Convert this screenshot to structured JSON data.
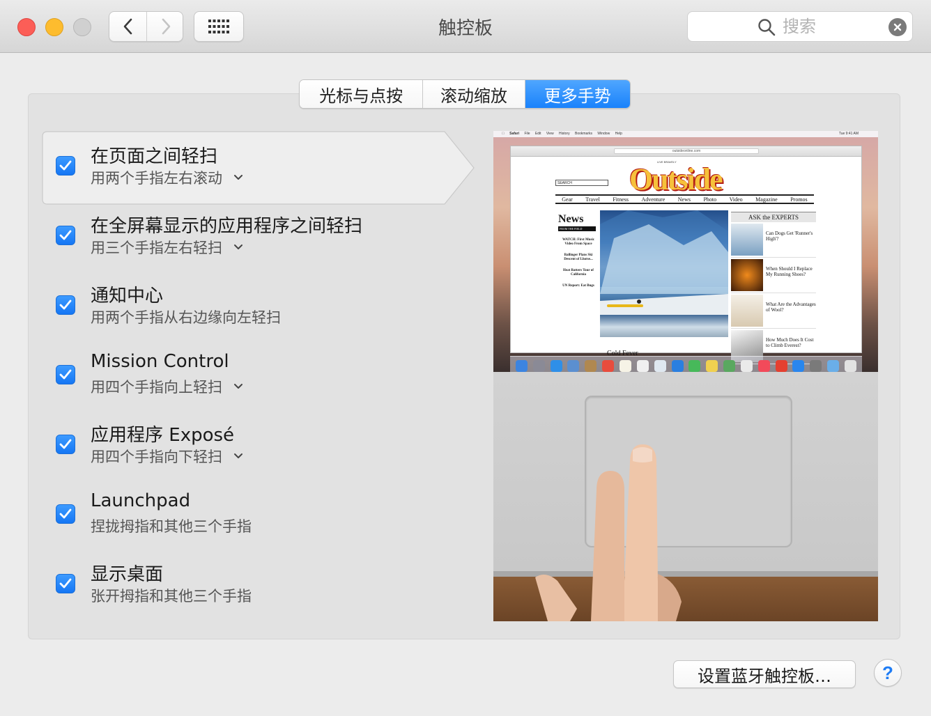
{
  "window": {
    "title": "触控板",
    "colors": {
      "close": "#fc5e57",
      "minimize": "#fdbc2e",
      "zoom_disabled": "#d0d0d0",
      "accent": "#1a82fb"
    }
  },
  "toolbar": {
    "back_icon": "chevron-left-icon",
    "forward_icon": "chevron-right-icon",
    "show_all_icon": "grid-icon",
    "search_placeholder": "搜索",
    "search_value": "",
    "clear_icon": "clear-circle-icon"
  },
  "tabs": [
    {
      "label": "光标与点按",
      "selected": false
    },
    {
      "label": "滚动缩放",
      "selected": false
    },
    {
      "label": "更多手势",
      "selected": true
    }
  ],
  "gestures": [
    {
      "title": "在页面之间轻扫",
      "subtitle": "用两个手指左右滚动",
      "checked": true,
      "has_menu": true,
      "selected": true
    },
    {
      "title": "在全屏幕显示的应用程序之间轻扫",
      "subtitle": "用三个手指左右轻扫",
      "checked": true,
      "has_menu": true,
      "selected": false
    },
    {
      "title": "通知中心",
      "subtitle": "用两个手指从右边缘向左轻扫",
      "checked": true,
      "has_menu": false,
      "selected": false
    },
    {
      "title": "Mission Control",
      "subtitle": "用四个手指向上轻扫",
      "checked": true,
      "has_menu": true,
      "selected": false
    },
    {
      "title": "应用程序 Exposé",
      "subtitle": "用四个手指向下轻扫",
      "checked": true,
      "has_menu": true,
      "selected": false
    },
    {
      "title": "Launchpad",
      "subtitle": "捏拢拇指和其他三个手指",
      "checked": true,
      "has_menu": false,
      "selected": false
    },
    {
      "title": "显示桌面",
      "subtitle": "张开拇指和其他三个手指",
      "checked": true,
      "has_menu": false,
      "selected": false
    }
  ],
  "preview": {
    "menubar": [
      "Safari",
      "File",
      "Edit",
      "View",
      "History",
      "Bookmarks",
      "Window",
      "Help"
    ],
    "clock": "Tue 9:41 AM",
    "url": "outsideonline.com",
    "site_tagline": "LIVE BRAVELY",
    "site_logo": "Outside",
    "site_search": "SEARCH",
    "site_nav": [
      "Gear",
      "Travel",
      "Fitness",
      "Adventure",
      "News",
      "Photo",
      "Video",
      "Magazine",
      "Promos"
    ],
    "news_heading": "News",
    "news_bar": "FROM THE FIELD",
    "news_items": [
      "WATCH: First Music Video From Space",
      "Ballinger Plans Ski Descent of Lhotse...",
      "Heat Batters Tour of California",
      "UN Report: Eat Bugs"
    ],
    "feature_caption": "Cold Fever",
    "experts_heading": "ASK the EXPERTS",
    "experts": [
      "Can Dogs Get 'Runner's High'?",
      "When Should I Replace My Running Shoes?",
      "What Are the Advantages of Wool?",
      "How Much Does It Cost to Climb Everest?"
    ]
  },
  "footer": {
    "bluetooth_button": "设置蓝牙触控板…",
    "help_label": "?"
  }
}
